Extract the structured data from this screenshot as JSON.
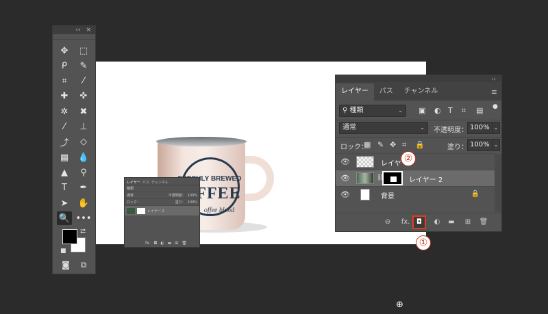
{
  "tools_panel": {
    "collapse": "‹‹",
    "close": "×",
    "tools": [
      {
        "name": "move-tool-icon",
        "glyph": "✥"
      },
      {
        "name": "marquee-tool-icon",
        "glyph": "⬚"
      },
      {
        "name": "lasso-tool-icon",
        "glyph": "ᑭ"
      },
      {
        "name": "quick-select-tool-icon",
        "glyph": "✎"
      },
      {
        "name": "crop-tool-icon",
        "glyph": "⌗"
      },
      {
        "name": "eyedropper-tool-icon",
        "glyph": "⁄"
      },
      {
        "name": "healing-brush-tool-icon",
        "glyph": "✚"
      },
      {
        "name": "bandage-tool-icon",
        "glyph": "✜"
      },
      {
        "name": "puppet-warp-tool-icon",
        "glyph": "✲"
      },
      {
        "name": "content-aware-move-tool-icon",
        "glyph": "✖"
      },
      {
        "name": "brush-tool-icon",
        "glyph": "⁄"
      },
      {
        "name": "clone-stamp-tool-icon",
        "glyph": "⊥"
      },
      {
        "name": "history-brush-tool-icon",
        "glyph": "⤴"
      },
      {
        "name": "eraser-tool-icon",
        "glyph": "◇"
      },
      {
        "name": "gradient-tool-icon",
        "glyph": "▦"
      },
      {
        "name": "blur-tool-icon",
        "glyph": "💧"
      },
      {
        "name": "sharpen-tool-icon",
        "glyph": "▲"
      },
      {
        "name": "dodge-tool-icon",
        "glyph": "⚲"
      },
      {
        "name": "type-tool-icon",
        "glyph": "T"
      },
      {
        "name": "pen-tool-icon",
        "glyph": "✒"
      },
      {
        "name": "path-selection-tool-icon",
        "glyph": "➤"
      },
      {
        "name": "hand-tool-icon",
        "glyph": "✋"
      },
      {
        "name": "zoom-tool-icon",
        "glyph": "🔍"
      },
      {
        "name": "more-tools-icon",
        "glyph": "•••"
      }
    ],
    "swap_colors": "⮂",
    "default_colors": "■",
    "quick_mask": "◙",
    "screen_mode": "⧉"
  },
  "mini_panel": {
    "tabs": [
      "レイヤー",
      "パス",
      "チャンネル"
    ],
    "filter": "種類",
    "mode": "通常",
    "opacity_label": "不透明度：",
    "opacity": "100%",
    "lock_label": "ロック：",
    "fill_label": "塗り：",
    "fill": "100%",
    "layer_name": "レイヤー 2"
  },
  "layers_panel": {
    "collapse": "‹‹",
    "close": "×",
    "tabs": [
      "レイヤー",
      "パス",
      "チャンネル"
    ],
    "menu": "≡",
    "filter_label": "種類",
    "blend_mode": "通常",
    "opacity_label": "不透明度：",
    "opacity": "100%",
    "lock_label": "ロック：",
    "fill_label": "塗り：",
    "fill": "100%",
    "layers": [
      {
        "name": "レイヤー",
        "thumb": "check"
      },
      {
        "name": "レイヤー 2",
        "thumb": "photo",
        "selected": true
      },
      {
        "name": "背景",
        "thumb": "white",
        "locked": true
      }
    ],
    "footer": {
      "link": "⊖",
      "fx": "fx.",
      "mask": "◘",
      "adjust": "◐",
      "group": "▬",
      "new": "⊞",
      "delete": "🗑"
    }
  },
  "mug": {
    "line1": "FRESHLY BREWED",
    "line2": "FFEE",
    "line3": "offee blend"
  },
  "callouts": [
    "①",
    "②"
  ],
  "cursor": "⊕"
}
